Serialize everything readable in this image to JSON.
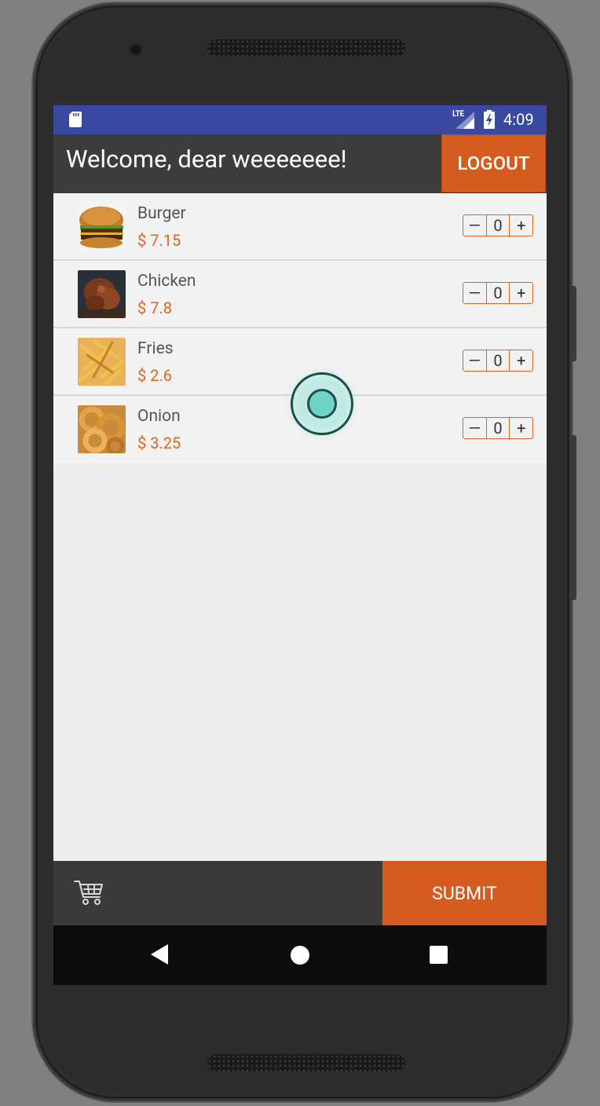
{
  "status_bar": {
    "network_label": "LTE",
    "time": "4:09",
    "icons": [
      "sd-card-icon",
      "signal-icon",
      "battery-charging-icon"
    ]
  },
  "header": {
    "welcome_text": "Welcome, dear weeeeeee!",
    "logout_label": "LOGOUT"
  },
  "menu": {
    "items": [
      {
        "name": "Burger",
        "price": "$ 7.15",
        "quantity": "0",
        "image": "burger-image"
      },
      {
        "name": "Chicken",
        "price": "$ 7.8",
        "quantity": "0",
        "image": "chicken-image"
      },
      {
        "name": "Fries",
        "price": "$ 2.6",
        "quantity": "0",
        "image": "fries-image"
      },
      {
        "name": "Onion",
        "price": "$ 3.25",
        "quantity": "0",
        "image": "onion-rings-image"
      }
    ],
    "minus_symbol": "—",
    "plus_symbol": "+"
  },
  "footer": {
    "submit_label": "SUBMIT",
    "cart_icon": "shopping-cart-icon"
  },
  "navigation": {
    "icons": [
      "back-icon",
      "home-icon",
      "recents-icon"
    ]
  },
  "colors": {
    "accent": "#d45c20",
    "price": "#e0641c",
    "status_bar": "#3949a0",
    "app_bar": "#3c3c3c"
  }
}
